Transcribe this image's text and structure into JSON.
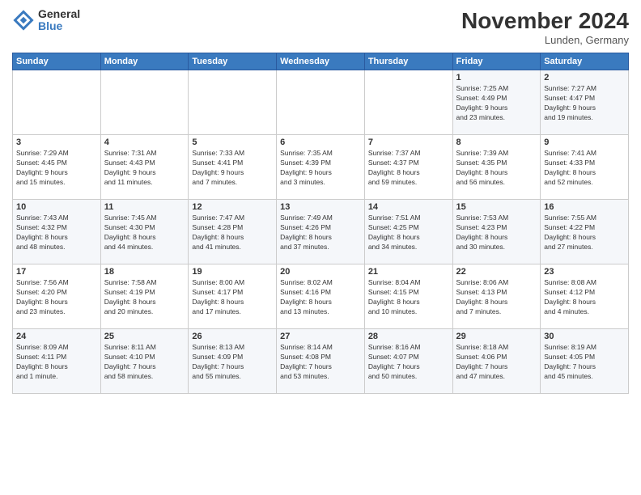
{
  "logo": {
    "line1": "General",
    "line2": "Blue"
  },
  "title": "November 2024",
  "location": "Lunden, Germany",
  "days_of_week": [
    "Sunday",
    "Monday",
    "Tuesday",
    "Wednesday",
    "Thursday",
    "Friday",
    "Saturday"
  ],
  "weeks": [
    [
      {
        "day": "",
        "info": ""
      },
      {
        "day": "",
        "info": ""
      },
      {
        "day": "",
        "info": ""
      },
      {
        "day": "",
        "info": ""
      },
      {
        "day": "",
        "info": ""
      },
      {
        "day": "1",
        "info": "Sunrise: 7:25 AM\nSunset: 4:49 PM\nDaylight: 9 hours\nand 23 minutes."
      },
      {
        "day": "2",
        "info": "Sunrise: 7:27 AM\nSunset: 4:47 PM\nDaylight: 9 hours\nand 19 minutes."
      }
    ],
    [
      {
        "day": "3",
        "info": "Sunrise: 7:29 AM\nSunset: 4:45 PM\nDaylight: 9 hours\nand 15 minutes."
      },
      {
        "day": "4",
        "info": "Sunrise: 7:31 AM\nSunset: 4:43 PM\nDaylight: 9 hours\nand 11 minutes."
      },
      {
        "day": "5",
        "info": "Sunrise: 7:33 AM\nSunset: 4:41 PM\nDaylight: 9 hours\nand 7 minutes."
      },
      {
        "day": "6",
        "info": "Sunrise: 7:35 AM\nSunset: 4:39 PM\nDaylight: 9 hours\nand 3 minutes."
      },
      {
        "day": "7",
        "info": "Sunrise: 7:37 AM\nSunset: 4:37 PM\nDaylight: 8 hours\nand 59 minutes."
      },
      {
        "day": "8",
        "info": "Sunrise: 7:39 AM\nSunset: 4:35 PM\nDaylight: 8 hours\nand 56 minutes."
      },
      {
        "day": "9",
        "info": "Sunrise: 7:41 AM\nSunset: 4:33 PM\nDaylight: 8 hours\nand 52 minutes."
      }
    ],
    [
      {
        "day": "10",
        "info": "Sunrise: 7:43 AM\nSunset: 4:32 PM\nDaylight: 8 hours\nand 48 minutes."
      },
      {
        "day": "11",
        "info": "Sunrise: 7:45 AM\nSunset: 4:30 PM\nDaylight: 8 hours\nand 44 minutes."
      },
      {
        "day": "12",
        "info": "Sunrise: 7:47 AM\nSunset: 4:28 PM\nDaylight: 8 hours\nand 41 minutes."
      },
      {
        "day": "13",
        "info": "Sunrise: 7:49 AM\nSunset: 4:26 PM\nDaylight: 8 hours\nand 37 minutes."
      },
      {
        "day": "14",
        "info": "Sunrise: 7:51 AM\nSunset: 4:25 PM\nDaylight: 8 hours\nand 34 minutes."
      },
      {
        "day": "15",
        "info": "Sunrise: 7:53 AM\nSunset: 4:23 PM\nDaylight: 8 hours\nand 30 minutes."
      },
      {
        "day": "16",
        "info": "Sunrise: 7:55 AM\nSunset: 4:22 PM\nDaylight: 8 hours\nand 27 minutes."
      }
    ],
    [
      {
        "day": "17",
        "info": "Sunrise: 7:56 AM\nSunset: 4:20 PM\nDaylight: 8 hours\nand 23 minutes."
      },
      {
        "day": "18",
        "info": "Sunrise: 7:58 AM\nSunset: 4:19 PM\nDaylight: 8 hours\nand 20 minutes."
      },
      {
        "day": "19",
        "info": "Sunrise: 8:00 AM\nSunset: 4:17 PM\nDaylight: 8 hours\nand 17 minutes."
      },
      {
        "day": "20",
        "info": "Sunrise: 8:02 AM\nSunset: 4:16 PM\nDaylight: 8 hours\nand 13 minutes."
      },
      {
        "day": "21",
        "info": "Sunrise: 8:04 AM\nSunset: 4:15 PM\nDaylight: 8 hours\nand 10 minutes."
      },
      {
        "day": "22",
        "info": "Sunrise: 8:06 AM\nSunset: 4:13 PM\nDaylight: 8 hours\nand 7 minutes."
      },
      {
        "day": "23",
        "info": "Sunrise: 8:08 AM\nSunset: 4:12 PM\nDaylight: 8 hours\nand 4 minutes."
      }
    ],
    [
      {
        "day": "24",
        "info": "Sunrise: 8:09 AM\nSunset: 4:11 PM\nDaylight: 8 hours\nand 1 minute."
      },
      {
        "day": "25",
        "info": "Sunrise: 8:11 AM\nSunset: 4:10 PM\nDaylight: 7 hours\nand 58 minutes."
      },
      {
        "day": "26",
        "info": "Sunrise: 8:13 AM\nSunset: 4:09 PM\nDaylight: 7 hours\nand 55 minutes."
      },
      {
        "day": "27",
        "info": "Sunrise: 8:14 AM\nSunset: 4:08 PM\nDaylight: 7 hours\nand 53 minutes."
      },
      {
        "day": "28",
        "info": "Sunrise: 8:16 AM\nSunset: 4:07 PM\nDaylight: 7 hours\nand 50 minutes."
      },
      {
        "day": "29",
        "info": "Sunrise: 8:18 AM\nSunset: 4:06 PM\nDaylight: 7 hours\nand 47 minutes."
      },
      {
        "day": "30",
        "info": "Sunrise: 8:19 AM\nSunset: 4:05 PM\nDaylight: 7 hours\nand 45 minutes."
      }
    ]
  ]
}
